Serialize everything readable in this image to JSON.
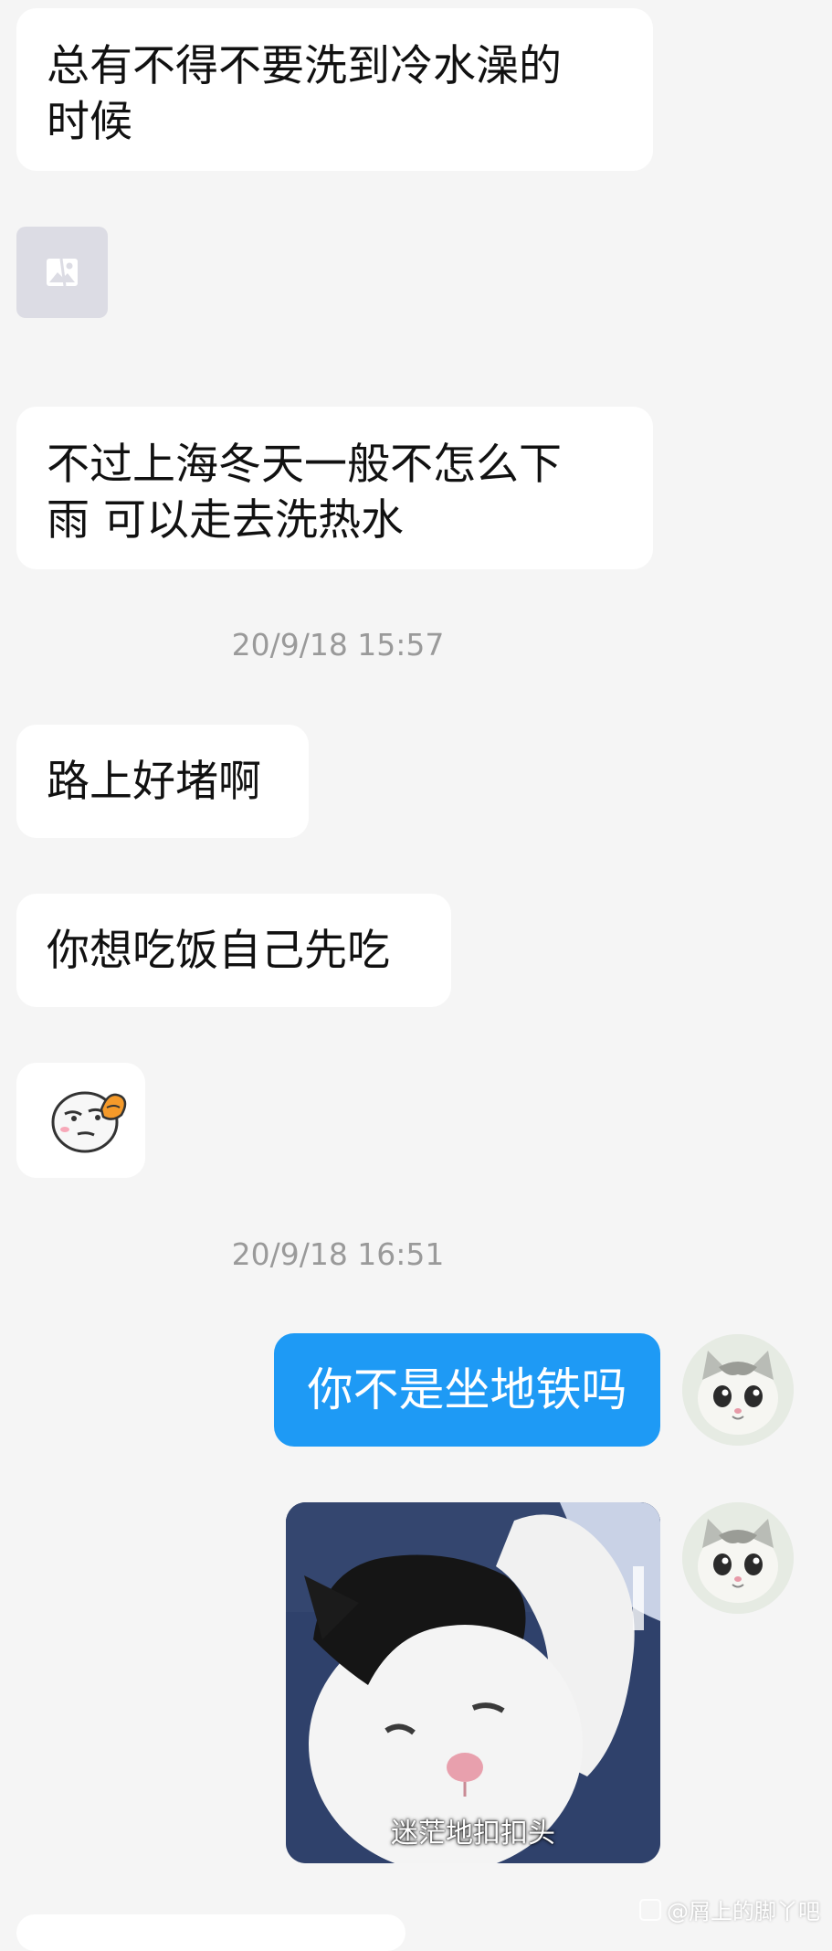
{
  "messages": {
    "m1": {
      "line1": "总有不得不要洗到冷水澡的",
      "line2": "时候"
    },
    "m2": {
      "line1": "不过上海冬天一般不怎么下",
      "line2": "雨 可以走去洗热水"
    },
    "m3": {
      "text": "路上好堵啊"
    },
    "m4": {
      "text": "你想吃饭自己先吃"
    },
    "m5": {
      "text": "你不是坐地铁吗"
    }
  },
  "timestamps": {
    "t1": "20/9/18 15:57",
    "t2": "20/9/18 16:51"
  },
  "cat_sticker": {
    "caption": "迷茫地扣扣头"
  },
  "watermark": {
    "text": "@屑上的脚丫吧"
  },
  "colors": {
    "background": "#f5f5f5",
    "incoming_bubble": "#ffffff",
    "outgoing_bubble": "#1e9af5",
    "timestamp_text": "#9a9a9a"
  },
  "icons": {
    "image_placeholder": "broken-image-icon",
    "emoji_sticker": "smirk-emoji-icon",
    "avatar": "cat-avatar-icon"
  }
}
